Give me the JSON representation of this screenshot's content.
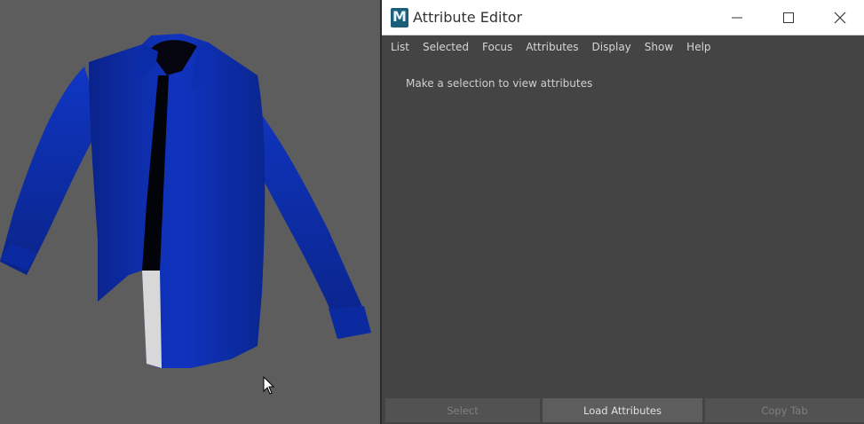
{
  "viewport": {
    "object": "blue long-sleeve shirt 3D model",
    "background_color": "#5d5d5d",
    "shirt_color": "#0e2fb4"
  },
  "window": {
    "title": "Attribute Editor",
    "app_icon": "maya-logo-icon",
    "controls": [
      "minimize-icon",
      "maximize-icon",
      "close-icon"
    ]
  },
  "menu": {
    "items": [
      "List",
      "Selected",
      "Focus",
      "Attributes",
      "Display",
      "Show",
      "Help"
    ]
  },
  "content": {
    "message": "Make a selection to view attributes"
  },
  "buttons": {
    "select": "Select",
    "load": "Load Attributes",
    "copy_tab": "Copy Tab"
  },
  "colors": {
    "panel_bg": "#444444",
    "button_bg": "#525252",
    "button_active_bg": "#5d5d5d"
  }
}
